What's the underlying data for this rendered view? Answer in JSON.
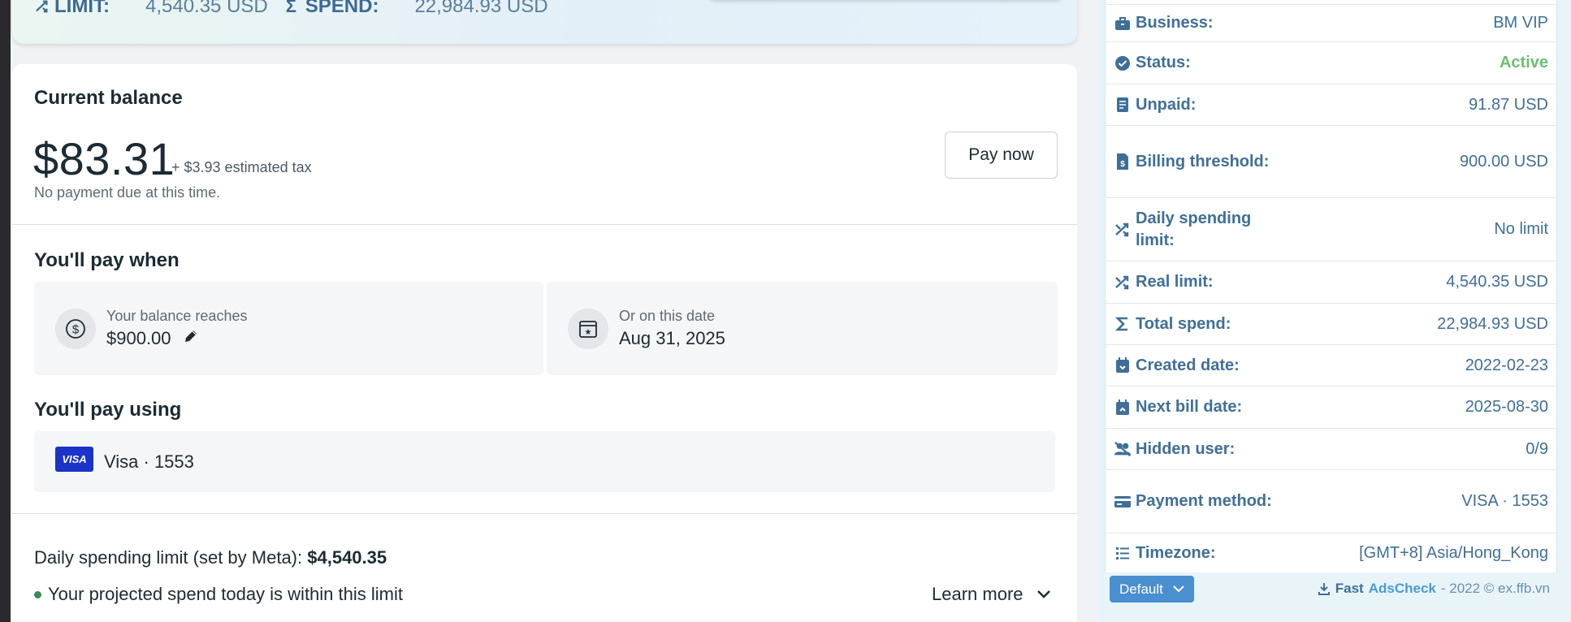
{
  "banner": {
    "limit_label": "LIMIT:",
    "limit_value": "4,540.35 USD",
    "spend_label": "SPEND:",
    "spend_value": "22,984.93 USD"
  },
  "balance_section": {
    "title": "Current balance",
    "amount": "$83.31",
    "tax": "+ $3.93 estimated tax",
    "status": "No payment due at this time.",
    "pay_button": "Pay now"
  },
  "pay_when": {
    "title": "You'll pay when",
    "balance_tile": {
      "label": "Your balance reaches",
      "value": "$900.00"
    },
    "date_tile": {
      "label": "Or on this date",
      "value": "Aug 31, 2025"
    }
  },
  "pay_using": {
    "title": "You'll pay using",
    "card_badge": "VISA",
    "card_text": "Visa · 1553"
  },
  "limit_info": {
    "prefix": "Daily spending limit (set by Meta):",
    "amount": "$4,540.35",
    "projection": "Your projected spend today is within this limit",
    "learn_more": "Learn more"
  },
  "account_panel": {
    "rows": [
      {
        "key": "Business:",
        "value": "BM VIP",
        "icon": "briefcase-icon"
      },
      {
        "key": "Status:",
        "value": "Active",
        "icon": "check-circle-icon"
      },
      {
        "key": "Unpaid:",
        "value": "91.87 USD",
        "icon": "receipt-icon"
      },
      {
        "key": "Billing threshold:",
        "value": "900.00 USD",
        "icon": "invoice-dollar-icon"
      },
      {
        "key": "Daily spending limit:",
        "value": "No limit",
        "icon": "shuffle-icon"
      },
      {
        "key": "Real limit:",
        "value": "4,540.35 USD",
        "icon": "shuffle-icon"
      },
      {
        "key": "Total spend:",
        "value": "22,984.93 USD",
        "icon": "sigma-icon"
      },
      {
        "key": "Created date:",
        "value": "2022-02-23",
        "icon": "calendar-down-icon"
      },
      {
        "key": "Next bill date:",
        "value": "2025-08-30",
        "icon": "calendar-up-icon"
      },
      {
        "key": "Hidden user:",
        "value": "0/9",
        "icon": "users-slash-icon"
      },
      {
        "key": "Payment method:",
        "value": "VISA · 1553",
        "icon": "credit-card-icon"
      },
      {
        "key": "Timezone:",
        "value": "[GMT+8] Asia/Hong_Kong",
        "icon": "list-icon"
      }
    ],
    "footer": {
      "default_button": "Default",
      "credit_fast": "Fast",
      "credit_brand": "AdsCheck",
      "credit_rest": "- 2022 © ex.ffb.vn"
    }
  },
  "colors": {
    "panel_text": "#3f6f99",
    "active_green": "#6bbf72",
    "visa_blue": "#1a33c9",
    "button_blue": "#4a8fd0"
  }
}
